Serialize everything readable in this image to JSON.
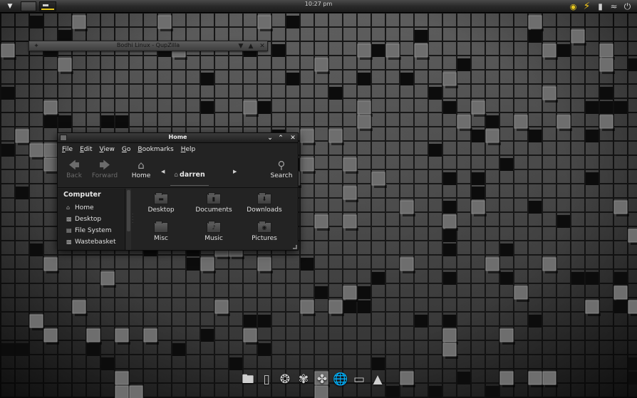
{
  "top_panel": {
    "clock": "10:27 pm",
    "menu_icon": "chevron-down-icon",
    "workspaces": [
      "workspace-1",
      "workspace-2"
    ],
    "tray_icons": [
      "headset-icon",
      "power-bolt-icon",
      "battery-icon",
      "wifi-icon",
      "shutdown-icon"
    ]
  },
  "qupzilla_window": {
    "title": "Bodhi Linux - QupZilla"
  },
  "file_manager": {
    "title": "Home",
    "menu": [
      {
        "underline": "F",
        "rest": "ile"
      },
      {
        "underline": "E",
        "rest": "dit"
      },
      {
        "underline": "V",
        "rest": "iew"
      },
      {
        "underline": "G",
        "rest": "o"
      },
      {
        "underline": "B",
        "rest": "ookmarks"
      },
      {
        "underline": "H",
        "rest": "elp"
      }
    ],
    "toolbar": {
      "back": "Back",
      "forward": "Forward",
      "home": "Home",
      "search": "Search",
      "current_path": "darren"
    },
    "sidebar": {
      "heading": "Computer",
      "items": [
        {
          "label": "Home",
          "icon": "home-icon"
        },
        {
          "label": "Desktop",
          "icon": "desktop-icon"
        },
        {
          "label": "File System",
          "icon": "drive-icon"
        },
        {
          "label": "Wastebasket",
          "icon": "trash-icon"
        }
      ]
    },
    "folders": [
      {
        "label": "Desktop",
        "icon": "desktop-folder-icon"
      },
      {
        "label": "Documents",
        "icon": "documents-folder-icon"
      },
      {
        "label": "Downloads",
        "icon": "downloads-folder-icon"
      },
      {
        "label": "Misc",
        "icon": "folder-icon"
      },
      {
        "label": "Music",
        "icon": "music-folder-icon"
      },
      {
        "label": "Pictures",
        "icon": "pictures-folder-icon"
      }
    ]
  },
  "dock": {
    "items": [
      "folder-icon",
      "ipod-icon",
      "firefox-icon",
      "inkscape-icon",
      "gimp-icon",
      "globe-icon",
      "terminal-icon",
      "vlc-cone-icon"
    ]
  },
  "colors": {
    "accent": "#e8c81f",
    "window_bg": "#232323",
    "panel_bg": "#1c1c1c"
  }
}
